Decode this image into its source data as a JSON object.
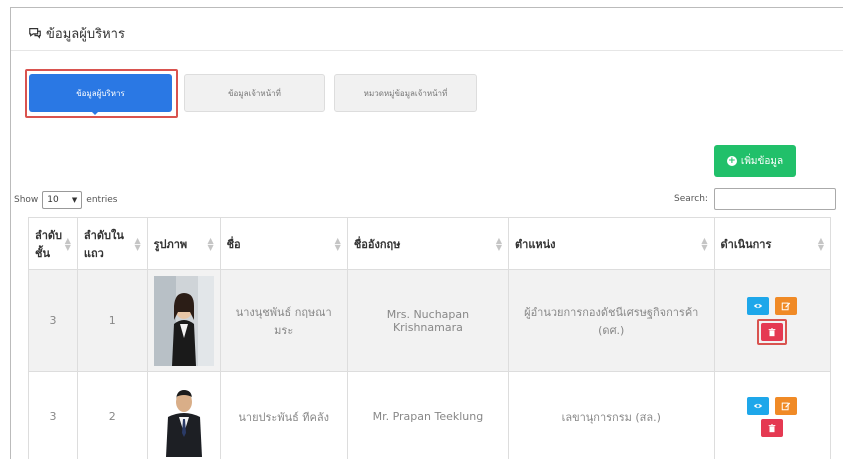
{
  "header": {
    "title": "ข้อมูลผู้บริหาร"
  },
  "tabs": [
    {
      "label": "ข้อมูลผู้บริหาร"
    },
    {
      "label": "ข้อมูลเจ้าหน้าที่"
    },
    {
      "label": "หมวดหมู่ข้อมูลเจ้าหน้าที่"
    }
  ],
  "toolbar": {
    "add_label": "เพิ่มข้อมูล"
  },
  "length_menu": {
    "show": "Show",
    "value": "10",
    "entries": "entries"
  },
  "search": {
    "label": "Search:"
  },
  "table": {
    "columns": [
      "ลำดับชั้น",
      "ลำดับในแถว",
      "รูปภาพ",
      "ชื่อ",
      "ชื่ออังกฤษ",
      "ตำแหน่ง",
      "ดำเนินการ"
    ],
    "rows": [
      {
        "level": "3",
        "order": "1",
        "name": "นางนุชพันธ์ กฤษณามระ",
        "name_en": "Mrs. Nuchapan Krishnamara",
        "position": "ผู้อำนวยการกองดัชนีเศรษฐกิจการค้า (ดศ.)"
      },
      {
        "level": "3",
        "order": "2",
        "name": "นายประพันธ์ ทีคลัง",
        "name_en": "Mr. Prapan Teeklung",
        "position": "เลขานุการกรม (สล.)"
      }
    ]
  },
  "colors": {
    "primary": "#2a78e4",
    "success": "#21c06a",
    "info": "#1ea7ea",
    "warning": "#f08a26",
    "danger": "#e53952"
  }
}
